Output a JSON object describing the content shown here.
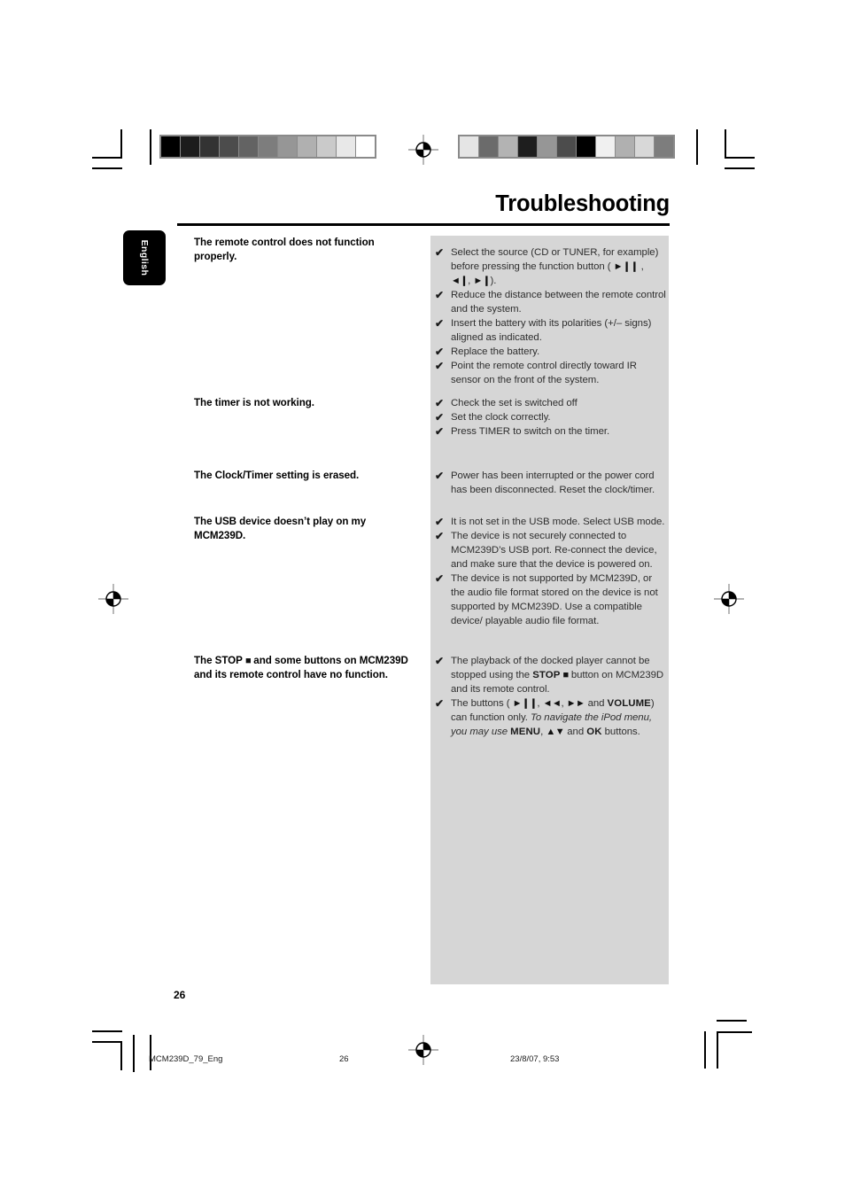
{
  "document": {
    "title": "Troubleshooting",
    "language_tab": "English",
    "page_number": "26"
  },
  "footer": {
    "filename": "MCM239D_79_Eng",
    "page": "26",
    "timestamp": "23/8/07, 9:53"
  },
  "colorbars": {
    "left": [
      "#000000",
      "#1c1c1c",
      "#333333",
      "#4c4c4c",
      "#636363",
      "#7d7d7d",
      "#969696",
      "#b0b0b0",
      "#cacaca",
      "#e8e8e8",
      "#ffffff"
    ],
    "right": [
      "#e5e5e5",
      "#6b6b6b",
      "#b3b3b3",
      "#1e1e1e",
      "#969696",
      "#4c4c4c",
      "#000000",
      "#f0f0f0",
      "#b0b0b0",
      "#d8d8d8",
      "#7d7d7d"
    ]
  },
  "entries": [
    {
      "problem": "The remote control does not function properly.",
      "solutions": [
        "Select the source (CD or TUNER, for example) before pressing the function button ( ▶▐▐ , ◀▐, ▶▐).",
        "Reduce the distance between the remote control and the system.",
        "Insert the battery with its polarities (+/– signs) aligned as indicated.",
        "Replace the battery.",
        "Point the remote control directly toward IR sensor on the front of the system."
      ]
    },
    {
      "problem": "The timer is not working.",
      "solutions": [
        "Check the set is switched off",
        "Set the clock correctly.",
        "Press TIMER to switch on the timer."
      ]
    },
    {
      "problem": "The Clock/Timer setting is erased.",
      "solutions": [
        "Power has been interrupted or the power cord has been disconnected. Reset the clock/timer."
      ]
    },
    {
      "problem": "The USB device doesn’t play on my MCM239D.",
      "solutions": [
        "It is not set in the USB mode. Select USB mode.",
        "The device is not securely connected to MCM239D’s USB port. Re-connect the device, and make sure that the device is powered on.",
        "The device is not supported by MCM239D, or the audio file format stored on the device is not supported by MCM239D. Use a compatible device/ playable audio file format."
      ]
    },
    {
      "problem": "The STOP ■ and some buttons on MCM239D and its remote control have no function.",
      "solutions": [
        "The playback of the docked player cannot be stopped using the STOP ■ button on MCM239D and its remote control.",
        "The buttons ( ▶▐▐, ◀◀, ▶▶ and VOLUME) can function only. To navigate the iPod menu, you may use MENU, ▲▼ and OK buttons."
      ]
    }
  ],
  "checkmark_glyph": "✔"
}
